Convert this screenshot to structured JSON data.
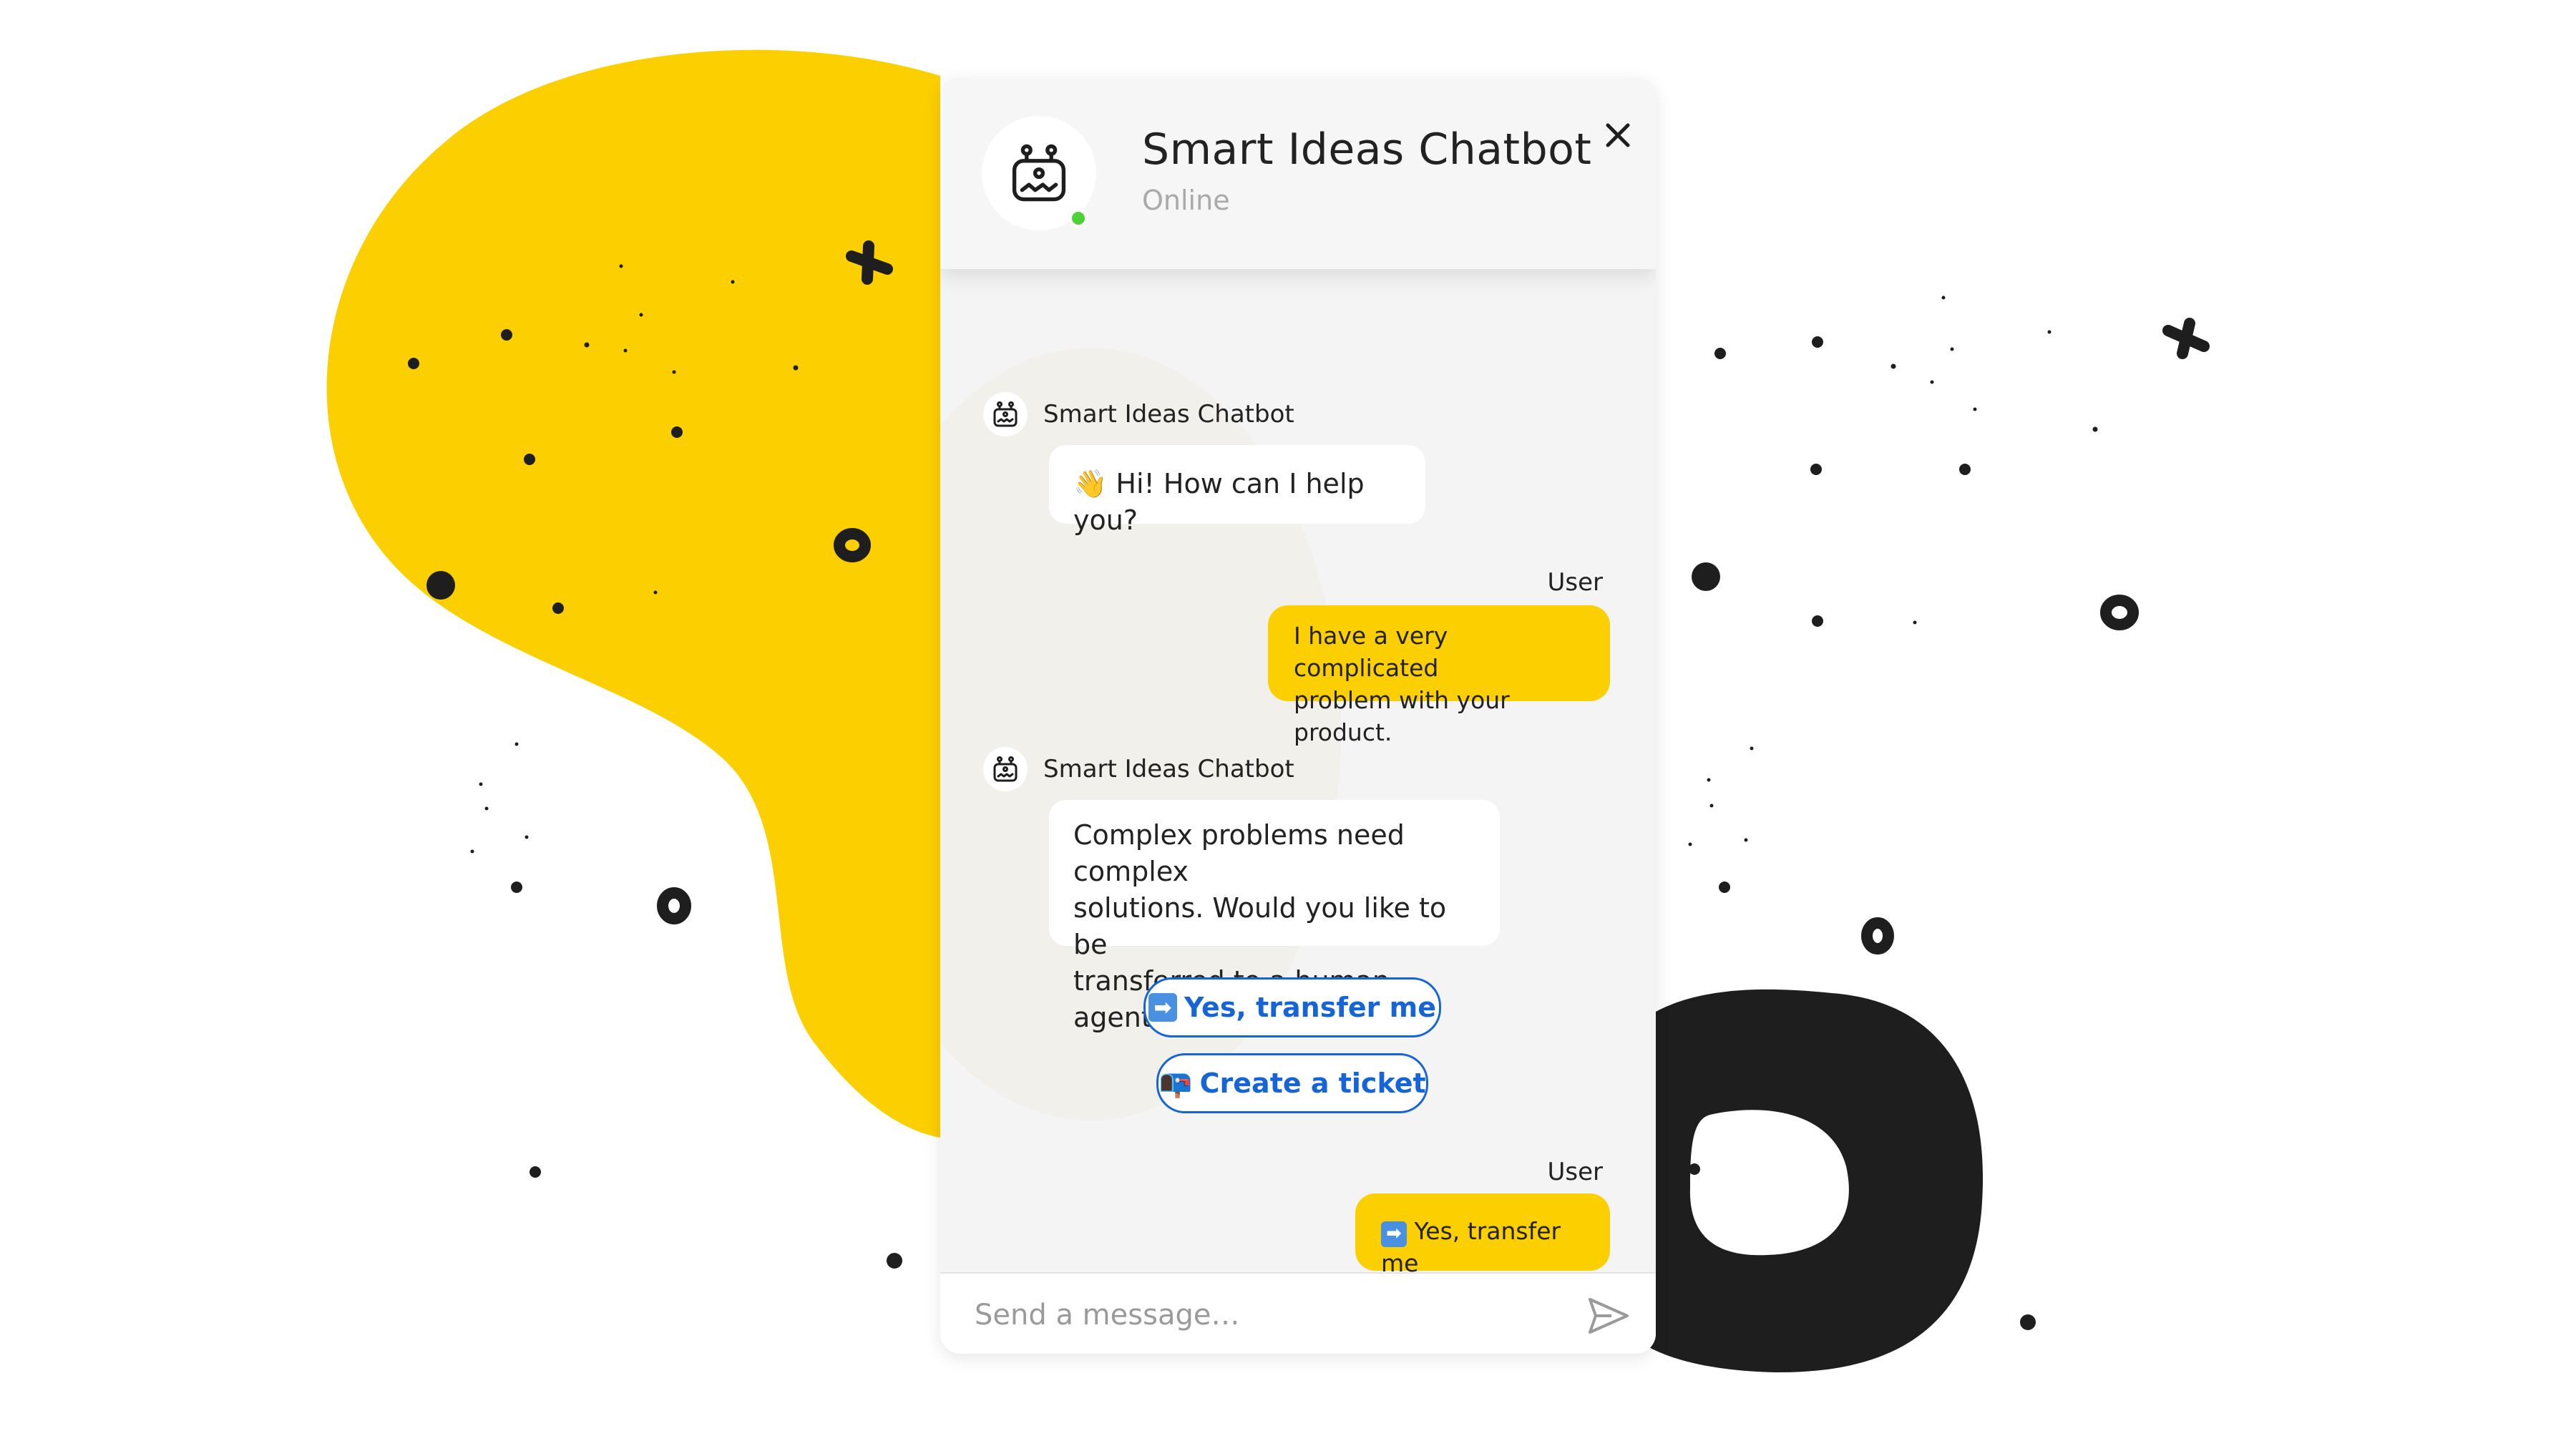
{
  "chatbot": {
    "title": "Smart Ideas Chatbot",
    "status": "Online"
  },
  "messages": [
    {
      "sender": "Smart Ideas Chatbot",
      "emoji": "👋",
      "text": "Hi! How can I help you?"
    },
    {
      "sender": "User",
      "text_lines": [
        "I have a very complicated",
        "problem with your product."
      ]
    },
    {
      "sender": "Smart Ideas Chatbot",
      "text_lines": [
        "Complex problems need complex",
        "solutions. Would you like to be",
        "transferred to a human agent?"
      ]
    },
    {
      "sender": "User",
      "emoji": "➡",
      "text": "Yes, transfer me"
    }
  ],
  "quick_replies": [
    {
      "emoji": "➡",
      "label": "Yes, transfer me"
    },
    {
      "emoji": "📭",
      "label": "Create a ticket"
    }
  ],
  "composer": {
    "placeholder": "Send a message…"
  },
  "colors": {
    "accent_yellow": "#fccf00",
    "link_blue": "#1565d8",
    "online_green": "#4cd137",
    "dark": "#1e1e1e"
  },
  "icons": [
    "robot-icon",
    "close-icon",
    "send-icon",
    "waving-hand-icon",
    "arrow-right-icon",
    "mailbox-icon"
  ]
}
